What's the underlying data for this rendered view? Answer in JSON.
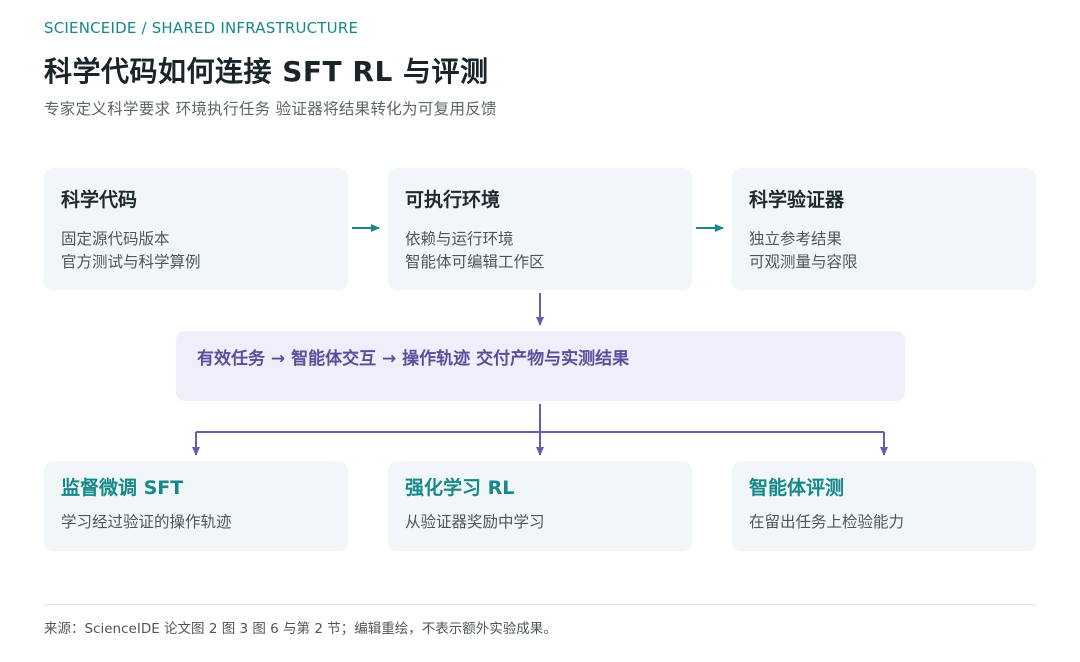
{
  "header": {
    "eyebrow": "SCIENCEIDE  /  SHARED INFRASTRUCTURE",
    "title": "科学代码如何连接 SFT  RL 与评测",
    "subtitle": "专家定义科学要求  环境执行任务  验证器将结果转化为可复用反馈"
  },
  "pipeline": [
    {
      "title": "科学代码",
      "lines": [
        "固定源代码版本",
        "官方测试与科学算例"
      ]
    },
    {
      "title": "可执行环境",
      "lines": [
        "依赖与运行环境",
        "智能体可编辑工作区"
      ]
    },
    {
      "title": "科学验证器",
      "lines": [
        "独立参考结果",
        "可观测量与容限"
      ]
    }
  ],
  "flow": {
    "text": "有效任务 → 智能体交互 → 操作轨迹 交付产物与实测结果"
  },
  "outputs": [
    {
      "title": "监督微调 SFT",
      "line": "学习经过验证的操作轨迹"
    },
    {
      "title": "强化学习 RL",
      "line": "从验证器奖励中学习"
    },
    {
      "title": "智能体评测",
      "line": "在留出任务上检验能力"
    }
  ],
  "footer": {
    "note": "来源：ScienceIDE 论文图 2 图 3 图 6 与第 2 节；编辑重绘，不表示额外实验成果。"
  },
  "colors": {
    "teal": "#17888a",
    "purple": "#6a5bb2",
    "box_bg": "#f1f7f9",
    "flow_bg": "#f1eefb"
  }
}
